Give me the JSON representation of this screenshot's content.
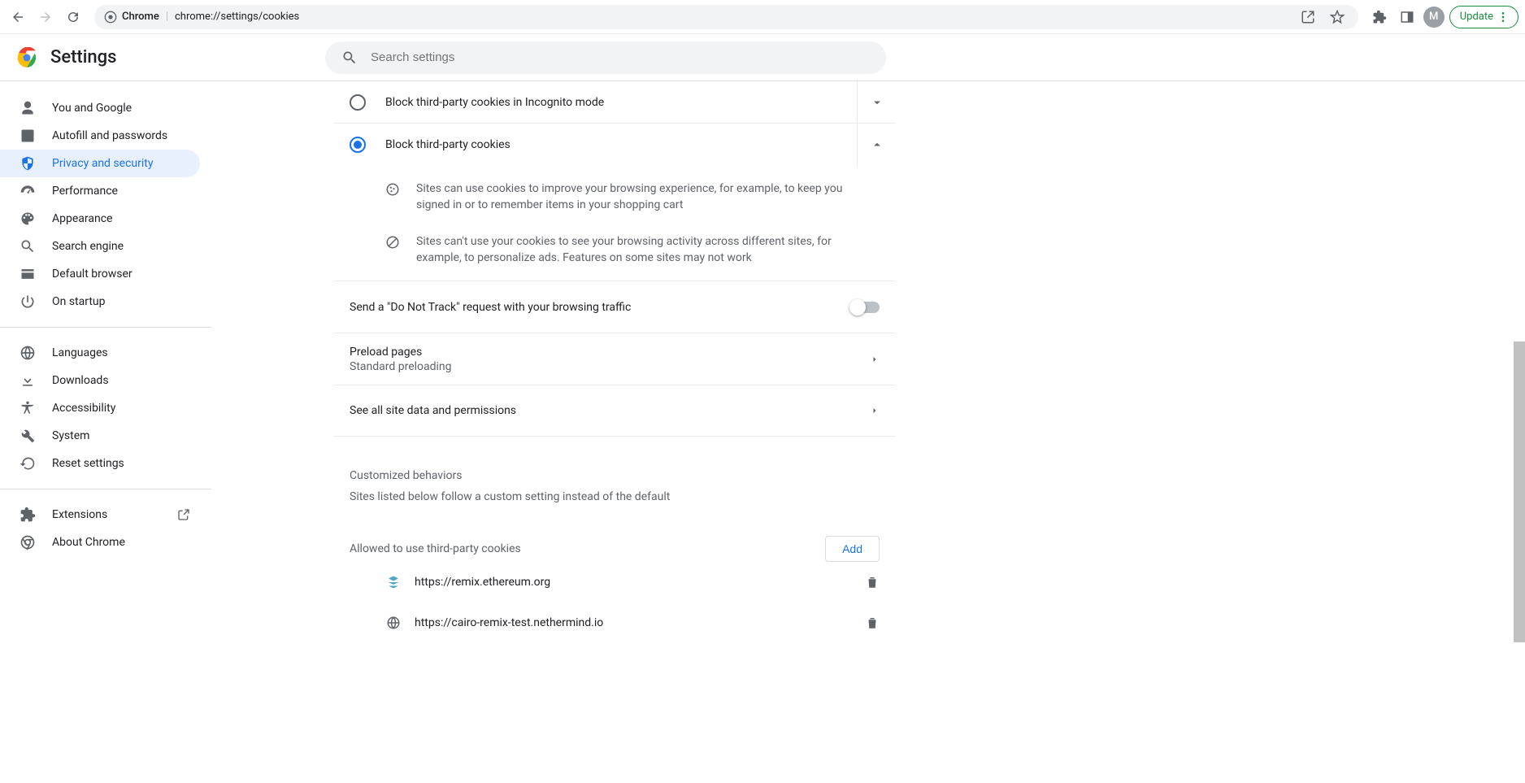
{
  "chrome": {
    "url_protocol": "Chrome",
    "url_path": "chrome://settings/cookies",
    "avatar_letter": "M",
    "update_label": "Update"
  },
  "header": {
    "title": "Settings",
    "search_placeholder": "Search settings"
  },
  "sidebar": {
    "items_a": [
      {
        "label": "You and Google",
        "icon": "person"
      },
      {
        "label": "Autofill and passwords",
        "icon": "assignment"
      },
      {
        "label": "Privacy and security",
        "icon": "shield",
        "active": true
      },
      {
        "label": "Performance",
        "icon": "speed"
      },
      {
        "label": "Appearance",
        "icon": "palette"
      },
      {
        "label": "Search engine",
        "icon": "search"
      },
      {
        "label": "Default browser",
        "icon": "browser"
      },
      {
        "label": "On startup",
        "icon": "power"
      }
    ],
    "items_b": [
      {
        "label": "Languages",
        "icon": "globe"
      },
      {
        "label": "Downloads",
        "icon": "download"
      },
      {
        "label": "Accessibility",
        "icon": "accessibility"
      },
      {
        "label": "System",
        "icon": "wrench"
      },
      {
        "label": "Reset settings",
        "icon": "restore"
      }
    ],
    "items_c": [
      {
        "label": "Extensions",
        "icon": "extension",
        "external": true
      },
      {
        "label": "About Chrome",
        "icon": "chrome"
      }
    ]
  },
  "cookies": {
    "option_incognito": "Block third-party cookies in Incognito mode",
    "option_block": "Block third-party cookies",
    "detail_improve": "Sites can use cookies to improve your browsing experience, for example, to keep you signed in or to remember items in your shopping cart",
    "detail_cant": "Sites can't use your cookies to see your browsing activity across different sites, for example, to personalize ads. Features on some sites may not work"
  },
  "rows": {
    "dnt": "Send a \"Do Not Track\" request with your browsing traffic",
    "preload_title": "Preload pages",
    "preload_sub": "Standard preloading",
    "see_all": "See all site data and permissions"
  },
  "custom": {
    "heading": "Customized behaviors",
    "sub": "Sites listed below follow a custom setting instead of the default",
    "allowed_heading": "Allowed to use third-party cookies",
    "add": "Add",
    "sites": [
      "https://remix.ethereum.org",
      "https://cairo-remix-test.nethermind.io"
    ]
  }
}
